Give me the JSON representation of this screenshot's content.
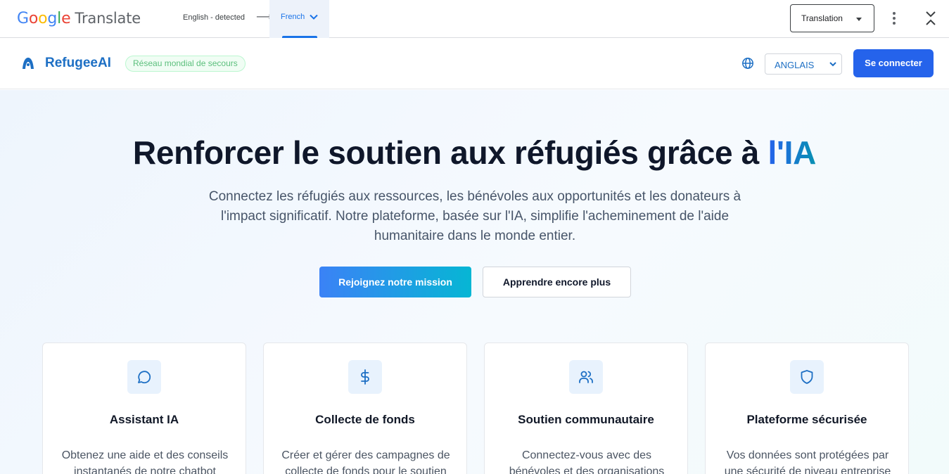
{
  "translate_bar": {
    "logo_letters": [
      "G",
      "o",
      "o",
      "g",
      "l",
      "e"
    ],
    "logo_colors": [
      "#4285f4",
      "#ea4335",
      "#fbbc05",
      "#4285f4",
      "#34a853",
      "#ea4335"
    ],
    "product_name": "Translate",
    "source_language": "English - detected",
    "arrow": "⟶",
    "target_language": "French",
    "mode_select": "Translation",
    "icons": [
      "chevron-down-icon",
      "more-vert-icon",
      "collapse-icon"
    ]
  },
  "header": {
    "brand_name": "RefugeeAI",
    "badge": "Réseau mondial de secours",
    "language": "ANGLAIS",
    "signin_label": "Se connecter",
    "brand_color": "#1d6fc4",
    "primary_color": "#2563eb",
    "icons": [
      "brand-logo-icon",
      "globe-icon",
      "chevron-down-icon"
    ]
  },
  "hero": {
    "title_main": "Renforcer le soutien aux réfugiés grâce à ",
    "title_accent": "l'IA",
    "subtitle": "Connectez les réfugiés aux ressources, les bénévoles aux opportunités et les donateurs à l'impact significatif. Notre plateforme, basée sur l'IA, simplifie l'acheminement de l'aide humanitaire dans le monde entier.",
    "primary_cta": "Rejoignez notre mission",
    "secondary_cta": "Apprendre encore plus"
  },
  "features": [
    {
      "icon": "chat-bubble-icon",
      "title": "Assistant IA",
      "description": "Obtenez une aide et des conseils instantanés de notre chatbot"
    },
    {
      "icon": "dollar-icon",
      "title": "Collecte de fonds",
      "description": "Créer et gérer des campagnes de collecte de fonds pour le soutien"
    },
    {
      "icon": "users-icon",
      "title": "Soutien communautaire",
      "description": "Connectez-vous avec des bénévoles et des organisations"
    },
    {
      "icon": "shield-icon",
      "title": "Plateforme sécurisée",
      "description": "Vos données sont protégées par une sécurité de niveau entreprise"
    }
  ]
}
